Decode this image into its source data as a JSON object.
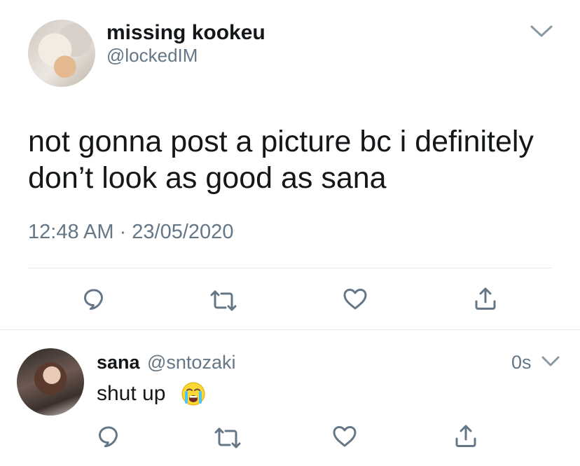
{
  "tweet": {
    "display_name": "missing kookeu",
    "handle": "@lockedIM",
    "text_line1": "not gonna post a picture bc i definitely",
    "text_line2": "don’t look as good as sana",
    "timestamp": "12:48 AM · 23/05/2020",
    "menu_icon": "chevron-down-icon",
    "actions": [
      "reply-icon",
      "retweet-icon",
      "like-icon",
      "share-icon"
    ]
  },
  "reply": {
    "display_name": "sana",
    "handle": "@sntozaki",
    "time": "0s",
    "text": "shut up",
    "emoji": "loudly-crying-face-emoji",
    "actions": [
      "reply-icon",
      "retweet-icon",
      "like-icon",
      "share-icon"
    ]
  },
  "colors": {
    "text": "#14171a",
    "secondary": "#657786",
    "icon": "#1da1f2",
    "divider": "#e1e8ed"
  }
}
